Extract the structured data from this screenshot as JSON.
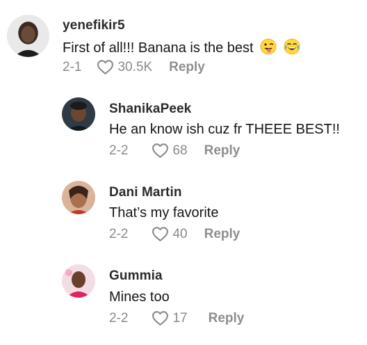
{
  "comments": [
    {
      "username": "yenefikir5",
      "text": "First of all!!! Banana is the best",
      "emojis": [
        "winking-tongue-face-emoji",
        "tears-of-joy-emoji"
      ],
      "date": "2-1",
      "likes": "30.5K",
      "reply_label": "Reply"
    },
    {
      "username": "ShanikaPeek",
      "text": "He an know ish cuz fr THEEE BEST!!",
      "date": "2-2",
      "likes": "68",
      "reply_label": "Reply"
    },
    {
      "username": "Dani Martin",
      "text": "That’s my favorite",
      "date": "2-2",
      "likes": "40",
      "reply_label": "Reply"
    },
    {
      "username": "Gummia",
      "text": "Mines too",
      "date": "2-2",
      "likes": "17",
      "reply_label": "Reply"
    }
  ]
}
